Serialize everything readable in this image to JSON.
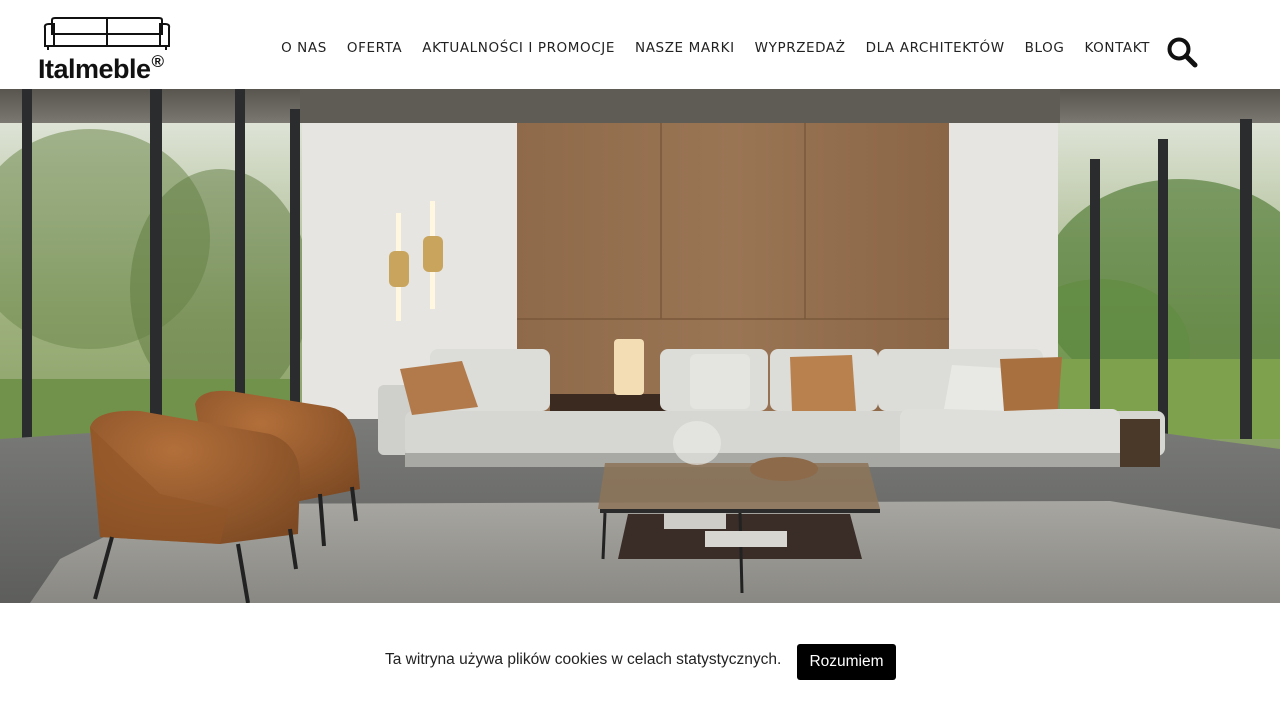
{
  "brand": {
    "name": "Italmeble",
    "reg": "®"
  },
  "nav": {
    "items": [
      {
        "label": "O NAS"
      },
      {
        "label": "OFERTA"
      },
      {
        "label": "AKTUALNOŚCI I PROMOCJE"
      },
      {
        "label": "NASZE MARKI"
      },
      {
        "label": "WYPRZEDAŻ"
      },
      {
        "label": "DLA ARCHITEKTÓW"
      },
      {
        "label": "BLOG"
      },
      {
        "label": "KONTAKT"
      }
    ],
    "search_icon": "search-icon"
  },
  "hero": {
    "image": "living-room-photo"
  },
  "cookie": {
    "text": "Ta witryna używa plików cookies w celach statystycznych.",
    "button": "Rozumiem"
  },
  "colors": {
    "text": "#222222",
    "button_bg": "#000000",
    "button_text": "#ffffff"
  }
}
